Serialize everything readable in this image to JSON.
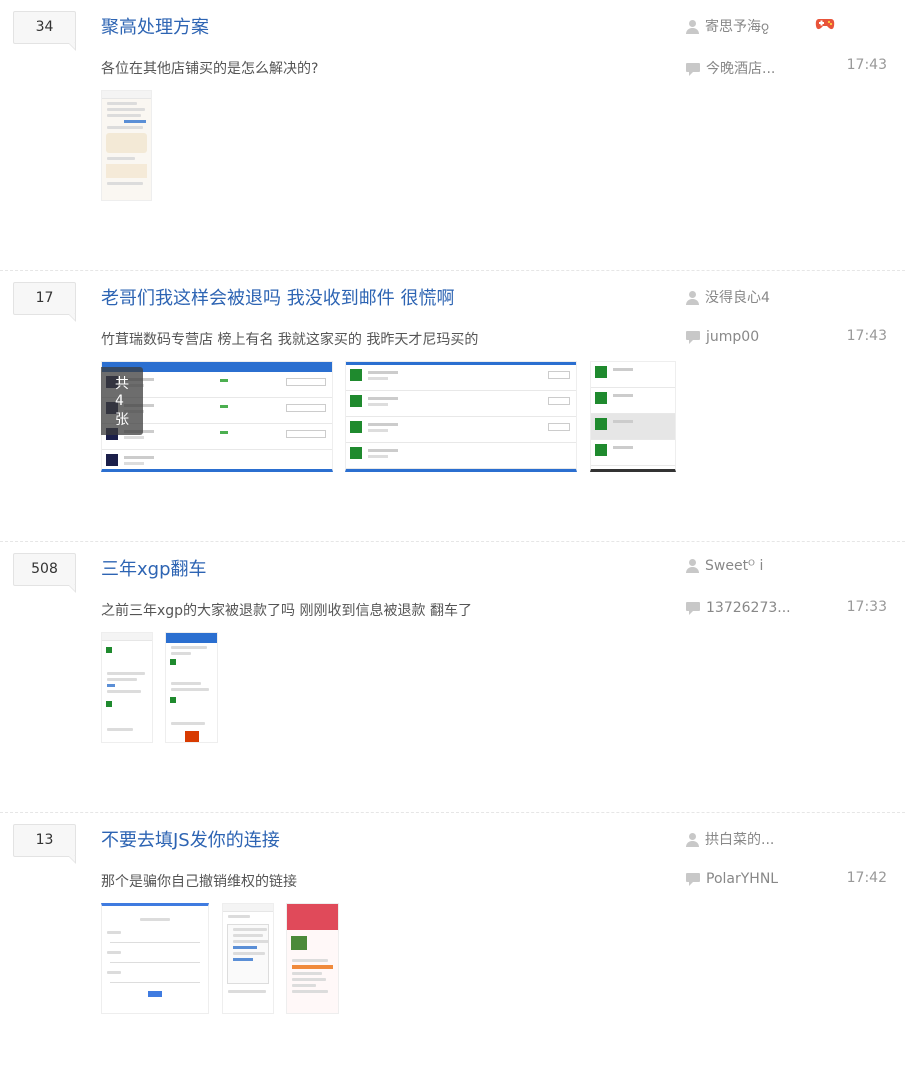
{
  "threads": [
    {
      "reply_count": "34",
      "title": "聚高处理方案",
      "abstract": "各位在其他店铺买的是怎么解决的?",
      "author": "寄思予海ჹ",
      "last_reply": "今晚酒店...",
      "time": "17:43",
      "pic_count": ""
    },
    {
      "reply_count": "17",
      "title": "老哥们我这样会被退吗 我没收到邮件 很慌啊",
      "abstract": "竹茸瑞数码专营店 榜上有名 我就这家买的 我昨天才尼玛买的",
      "author": "没得良心4",
      "last_reply": "jump00",
      "time": "17:43",
      "pic_count": "共 4 张"
    },
    {
      "reply_count": "508",
      "title": "三年xgp翻车",
      "abstract": "之前三年xgp的大家被退款了吗 刚刚收到信息被退款 翻车了",
      "author": "Sweetᴼ  i",
      "last_reply": "13726273...",
      "time": "17:33",
      "pic_count": ""
    },
    {
      "reply_count": "13",
      "title": "不要去填JS发你的连接",
      "abstract": "那个是骗你自己撤销维权的链接",
      "author": "拱白菜的...",
      "last_reply": "PolarYHNL",
      "time": "17:42",
      "pic_count": ""
    }
  ],
  "icons": {
    "author": "user-icon",
    "reply": "reply-icon",
    "badge": "game-controller-icon"
  },
  "colors": {
    "title": "#2d64b3",
    "badge": "#e8543a"
  }
}
